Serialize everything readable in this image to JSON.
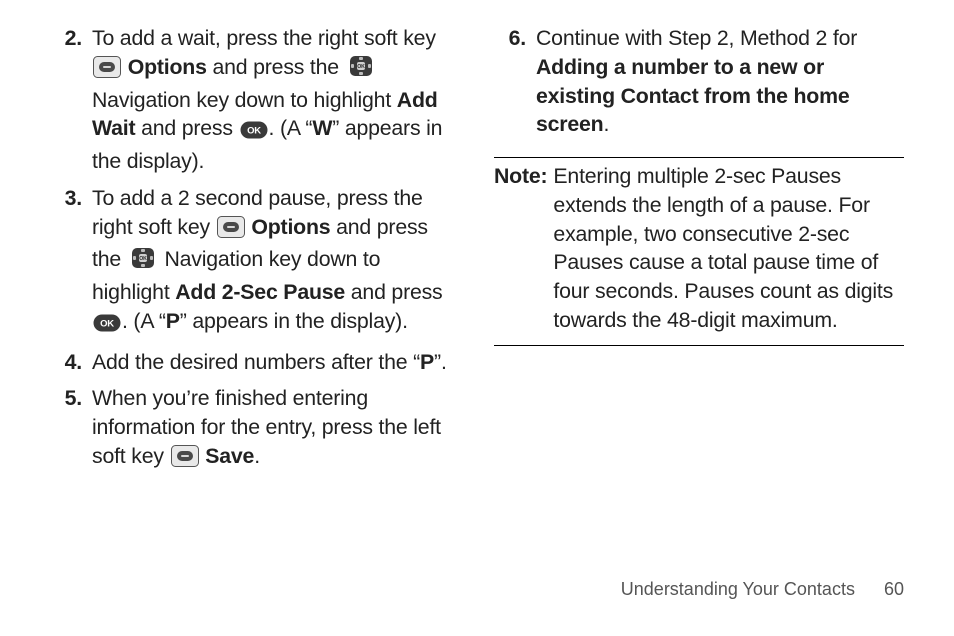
{
  "left": {
    "items": [
      {
        "num": "2.",
        "parts": [
          {
            "t": "text",
            "v": "To add a wait, press the right soft key "
          },
          {
            "t": "icon",
            "v": "softkey"
          },
          {
            "t": "text",
            "v": " "
          },
          {
            "t": "bold",
            "v": "Options"
          },
          {
            "t": "text",
            "v": " and press the "
          },
          {
            "t": "icon",
            "v": "nav"
          },
          {
            "t": "text",
            "v": " Navigation key down to highlight "
          },
          {
            "t": "bold",
            "v": "Add Wait"
          },
          {
            "t": "text",
            "v": " and press "
          },
          {
            "t": "icon",
            "v": "ok"
          },
          {
            "t": "text",
            "v": ". (A “"
          },
          {
            "t": "bold",
            "v": "W"
          },
          {
            "t": "text",
            "v": "” appears in the display)."
          }
        ]
      },
      {
        "num": "3.",
        "parts": [
          {
            "t": "text",
            "v": "To add a 2 second pause, press the right soft key "
          },
          {
            "t": "icon",
            "v": "softkey"
          },
          {
            "t": "text",
            "v": " "
          },
          {
            "t": "bold",
            "v": "Options"
          },
          {
            "t": "text",
            "v": " and press the "
          },
          {
            "t": "icon",
            "v": "nav"
          },
          {
            "t": "text",
            "v": " Navigation key down to highlight "
          },
          {
            "t": "bold",
            "v": "Add 2-Sec Pause"
          },
          {
            "t": "text",
            "v": " and press "
          },
          {
            "t": "icon",
            "v": "ok"
          },
          {
            "t": "text",
            "v": ". (A “"
          },
          {
            "t": "bold",
            "v": "P"
          },
          {
            "t": "text",
            "v": "” appears in the display)."
          }
        ]
      },
      {
        "num": "4.",
        "parts": [
          {
            "t": "text",
            "v": "Add the desired numbers after the “"
          },
          {
            "t": "bold",
            "v": "P"
          },
          {
            "t": "text",
            "v": "”."
          }
        ]
      },
      {
        "num": "5.",
        "parts": [
          {
            "t": "text",
            "v": "When you’re finished entering information for the entry, press the left soft key "
          },
          {
            "t": "icon",
            "v": "softkey"
          },
          {
            "t": "text",
            "v": " "
          },
          {
            "t": "bold",
            "v": "Save"
          },
          {
            "t": "text",
            "v": "."
          }
        ]
      }
    ]
  },
  "right": {
    "items": [
      {
        "num": "6.",
        "parts": [
          {
            "t": "text",
            "v": "Continue with Step 2, Method 2 for "
          },
          {
            "t": "bold",
            "v": "Adding a number to a new or existing Contact from the home screen"
          },
          {
            "t": "text",
            "v": "."
          }
        ]
      }
    ],
    "note": {
      "label": "Note:",
      "body": "Entering multiple 2-sec Pauses extends the length of a pause. For example, two consecutive 2-sec Pauses cause a total pause time of four seconds. Pauses count as digits towards the 48-digit maximum."
    }
  },
  "footer": {
    "section": "Understanding Your Contacts",
    "page": "60"
  },
  "icons": {
    "softkey": "softkey-icon",
    "nav": "nav-ok-icon",
    "ok": "ok-pill-icon"
  }
}
